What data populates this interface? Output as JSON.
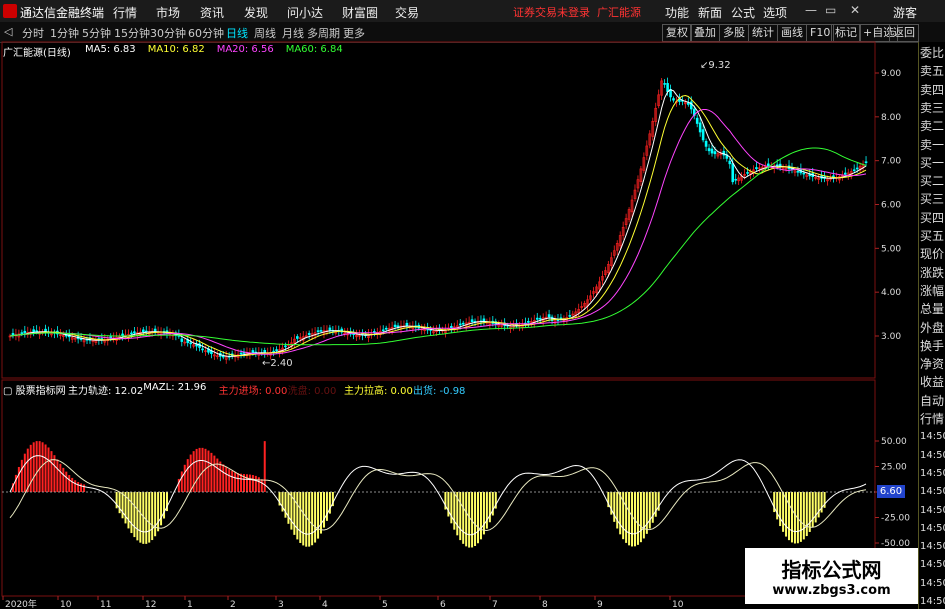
{
  "app_title": "通达信金融终端",
  "menus": [
    "行情",
    "市场",
    "资讯",
    "发现",
    "问小达",
    "财富圈",
    "交易"
  ],
  "warning": "证券交易未登录",
  "stock_name": "广汇能源",
  "right_menus": [
    "功能",
    "新面",
    "公式",
    "选项"
  ],
  "user": "游客",
  "periods": [
    "分时",
    "1分钟",
    "5分钟",
    "15分钟",
    "30分钟",
    "60分钟",
    "日线",
    "周线",
    "月线",
    "多周期",
    "更多"
  ],
  "active_period": "日线",
  "tools": [
    "复权",
    "叠加",
    "多股",
    "统计",
    "画线",
    "F10",
    "标记",
    "+自选",
    "返回"
  ],
  "main_legend": {
    "title": "广汇能源(日线)",
    "items": [
      {
        "label": "MA5: 6.83",
        "color": "#ffffff"
      },
      {
        "label": "MA10: 6.82",
        "color": "#ffff33"
      },
      {
        "label": "MA20: 6.56",
        "color": "#ff44ff"
      },
      {
        "label": "MA60: 6.84",
        "color": "#33ff33"
      }
    ]
  },
  "ind_legend": {
    "title": "股票指标网",
    "items": [
      {
        "label": "主力轨迹: 12.02",
        "color": "#ffffff"
      },
      {
        "label": "MAZL: 21.96",
        "color": "#ffffff"
      },
      {
        "label": "主力进场: 0.00",
        "color": "#ff3333"
      },
      {
        "label": "洗盘: 0.00",
        "color": "#661111"
      },
      {
        "label": "主力拉高: 0.00",
        "color": "#ffff33"
      },
      {
        "label": "出货: -0.98",
        "color": "#33ccff"
      }
    ]
  },
  "price_axis": [
    "9.00",
    "8.00",
    "7.00",
    "6.00",
    "5.00",
    "4.00",
    "3.00"
  ],
  "ind_axis": [
    "50.00",
    "25.00",
    "0.00",
    "-25.00",
    "-50.00"
  ],
  "current_value": "6.60",
  "high_mark": "9.32",
  "low_mark": "2.40",
  "time_axis": [
    "2020年",
    "10",
    "11",
    "12",
    "1",
    "2",
    "3",
    "4",
    "5",
    "6",
    "7",
    "8",
    "9",
    "10"
  ],
  "side_panel": [
    "委比",
    "卖五",
    "卖四",
    "卖三",
    "卖二",
    "卖一",
    "买一",
    "买二",
    "买三",
    "买四",
    "买五",
    "现价",
    "涨跌",
    "涨幅",
    "总量",
    "外盘",
    "换手",
    "净资",
    "收益",
    "自动",
    "行情",
    "14:50",
    "14:50",
    "14:50",
    "14:50",
    "14:50",
    "14:50",
    "14:50",
    "14:50",
    "14:50",
    "14:50"
  ],
  "watermark": {
    "line1": "指标公式网",
    "line2": "www.zbgs3.com"
  },
  "colors": {
    "up": "#ff2222",
    "down": "#00ffff",
    "ma5": "#ffffff",
    "ma10": "#ffff33",
    "ma20": "#ff44ff",
    "ma60": "#33ff33"
  }
}
